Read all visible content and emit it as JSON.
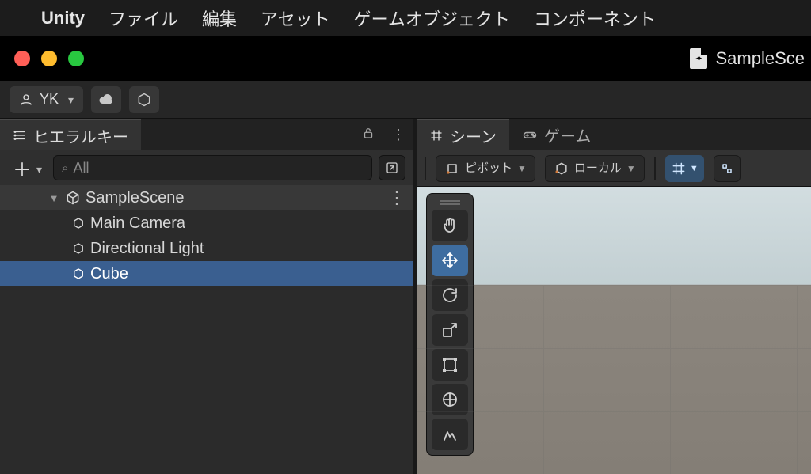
{
  "menubar": {
    "app_name": "Unity",
    "items": [
      "ファイル",
      "編集",
      "アセット",
      "ゲームオブジェクト",
      "コンポーネント"
    ]
  },
  "titlebar": {
    "scene_file": "SampleSce"
  },
  "toolbar": {
    "user_label": "YK"
  },
  "hierarchy": {
    "tab_label": "ヒエラルキー",
    "search_placeholder": "All",
    "scene_name": "SampleScene",
    "items": [
      {
        "name": "Main Camera"
      },
      {
        "name": "Directional Light"
      },
      {
        "name": "Cube",
        "selected": true
      }
    ]
  },
  "scene_panel": {
    "tabs": {
      "scene": "シーン",
      "game": "ゲーム"
    },
    "pivot_label": "ピボット",
    "space_label": "ローカル"
  }
}
